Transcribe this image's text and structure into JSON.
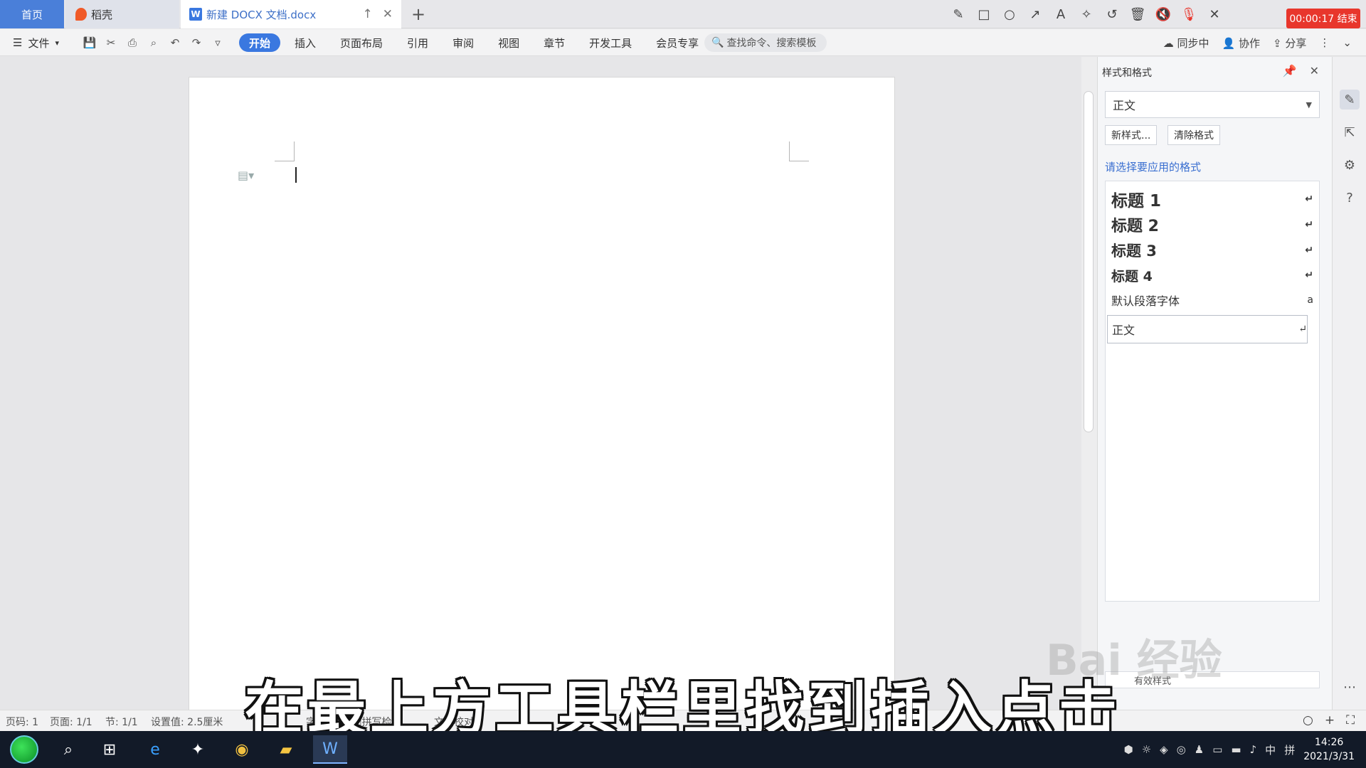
{
  "tabs": {
    "home": "首页",
    "daoke": "稻壳",
    "doc": "新建 DOCX 文档.docx",
    "new_tab": "+"
  },
  "recorder": {
    "timer": "00:00:17 结束"
  },
  "ribbon": {
    "file": "文件",
    "tabs": [
      "开始",
      "插入",
      "页面布局",
      "引用",
      "审阅",
      "视图",
      "章节",
      "开发工具",
      "会员专享"
    ],
    "search_placeholder": "查找命令、搜索模板",
    "sync": "同步中",
    "collab": "协作",
    "share": "分享"
  },
  "panel": {
    "title": "样式和格式",
    "current_style": "正文",
    "new_style_btn": "新样式...",
    "clear_format_btn": "清除格式",
    "prompt": "请选择要应用的格式",
    "styles": [
      {
        "name": "标题 1",
        "mark": "↵"
      },
      {
        "name": "标题 2",
        "mark": "↵"
      },
      {
        "name": "标题 3",
        "mark": "↵"
      },
      {
        "name": "标题 4",
        "mark": "↵"
      },
      {
        "name": "默认段落字体",
        "mark": "a"
      },
      {
        "name": "正文",
        "mark": "↵"
      }
    ],
    "show_label": "有效样式"
  },
  "status": {
    "page_code": "页码: 1",
    "pages": "页面: 1/1",
    "section": "节: 1/1",
    "setting": "设置值: 2.5厘米",
    "word_count": "字数: 0",
    "spell_check": "拼写检查",
    "proofread": "文档校对"
  },
  "caption": "在最上方工具栏里找到插入点击",
  "watermark": "Bai 经验",
  "taskbar": {
    "time": "14:26",
    "date": "2021/3/31",
    "ime": "中",
    "ime2": "拼"
  },
  "colors": {
    "accent": "#3a78e0",
    "record": "#e8362c",
    "taskbar": "#121a28"
  }
}
